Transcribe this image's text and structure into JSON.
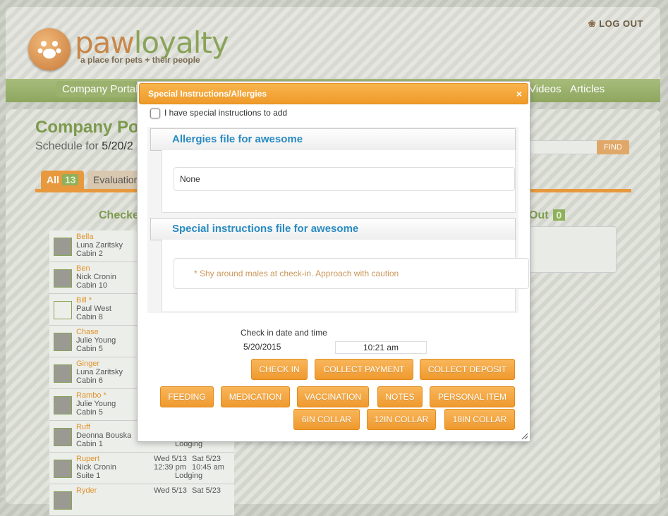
{
  "header": {
    "brand_a": "paw",
    "brand_b": "loyalty",
    "tagline": "a place for pets + their people",
    "logout": "LOG OUT"
  },
  "nav": {
    "items": [
      "Company Portal",
      "Videos",
      "Articles"
    ]
  },
  "page": {
    "title": "Company Po",
    "schedule_label": "Schedule for ",
    "schedule_date": "5/20/2",
    "find": "FIND",
    "tab_all": "All",
    "tab_all_count": "13",
    "tab_eval": "Evaluation",
    "checked_label": "Checke",
    "out_label": "Out",
    "out_count": "0"
  },
  "pets": [
    {
      "name": "Bella",
      "owner": "Luna Zaritsky",
      "cabin": "Cabin 2"
    },
    {
      "name": "Ben",
      "owner": "Nick Cronin",
      "cabin": "Cabin 10"
    },
    {
      "name": "Bill *",
      "owner": "Paul West",
      "cabin": "Cabin 8"
    },
    {
      "name": "Chase",
      "owner": "Julie Young",
      "cabin": "Cabin 5"
    },
    {
      "name": "Ginger",
      "owner": "Luna Zaritsky",
      "cabin": "Cabin 6"
    },
    {
      "name": "Rambo *",
      "owner": "Julie Young",
      "cabin": "Cabin 5"
    },
    {
      "name": "Ruff",
      "owner": "Deonna Bouska",
      "cabin": "Cabin 1",
      "service": "Lodging"
    },
    {
      "name": "Rupert",
      "owner": "Nick Cronin",
      "cabin": "Suite 1",
      "d1": "Wed 5/13",
      "d2": "Sat 5/23",
      "t1": "12:39 pm",
      "t2": "10:45 am",
      "service": "Lodging"
    },
    {
      "name": "Ryder",
      "owner": "",
      "cabin": "",
      "d1": "Wed 5/13",
      "d2": "Sat 5/23"
    }
  ],
  "dialog": {
    "title": "Special Instructions/Allergies",
    "close": "×",
    "checkbox_label": "I have special instructions to add",
    "allergies_heading": "Allergies file for awesome",
    "allergies_value": "None",
    "instructions_heading": "Special instructions file for awesome",
    "instructions_value": "* Shy around males at check-in. Approach with caution",
    "checkin_label": "Check in date and time",
    "checkin_date": "5/20/2015",
    "checkin_time": "10:21 am",
    "buttons": {
      "check_in": "CHECK IN",
      "collect_payment": "COLLECT PAYMENT",
      "collect_deposit": "COLLECT DEPOSIT",
      "feeding": "FEEDING",
      "medication": "MEDICATION",
      "vaccination": "VACCINATION",
      "notes": "NOTES",
      "personal_item": "PERSONAL ITEM",
      "collar6": "6IN COLLAR",
      "collar12": "12IN COLLAR",
      "collar18": "18IN COLLAR"
    }
  }
}
